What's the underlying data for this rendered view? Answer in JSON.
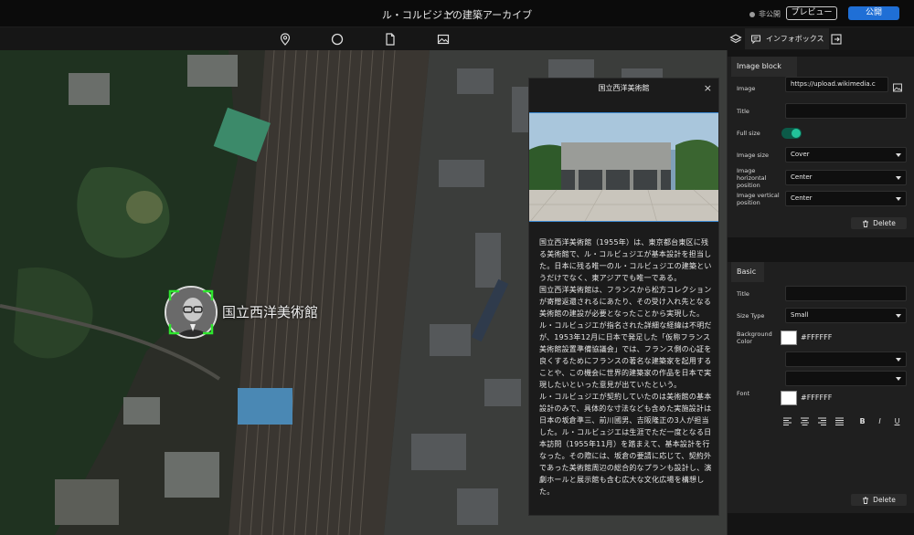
{
  "app": {
    "title": "ル・コルビジェの建築アーカイブ",
    "status": "非公開",
    "preview_label": "プレビュー",
    "publish_label": "公開"
  },
  "colors": {
    "accent": "#1f6fd6",
    "toggle_on": "#22c39a",
    "panel_bg": "#1f1f1f",
    "infobox_bg": "#1b1b1b",
    "marker_frame": "#2ee62e"
  },
  "toolbar": {
    "icons": [
      "pin-icon",
      "circle-icon",
      "file-icon",
      "image-icon"
    ],
    "right_icons": [
      "layers-icon",
      "comment-icon",
      "exit-icon"
    ],
    "info_tab_label": "インフォボックス"
  },
  "map": {
    "marker_label": "国立西洋美術館"
  },
  "infobox": {
    "title": "国立西洋美術館",
    "close": "×",
    "paragraphs": [
      "国立西洋美術館（1955年）は、東京都台東区に残る美術館で、ル・コルビュジエが基本設計を担当した。日本に残る唯一のル・コルビュジエの建築というだけでなく、東アジアでも唯一である。",
      "国立西洋美術館は、フランスから松方コレクションが寄贈返還されるにあたり、その受け入れ先となる美術館の建設が必要となったことから実現した。ル・コルビュジエが指名された詳細な経緯は不明だが、1953年12月に日本で発足した「仮称フランス美術館設置準備協議会」では、フランス側の心証を良くするためにフランスの著名な建築家を起用することや、この機会に世界的建築家の作品を日本で実現したいといった意見が出ていたという。",
      "ル・コルビュジエが契約していたのは美術館の基本設計のみで、具体的な寸法なども含めた実施設計は日本の坂倉準三、前川國男、吉阪隆正の3人が担当した。ル・コルビュジエは生涯でただ一度となる日本訪問（1955年11月）を踏まえて、基本設計を行なった。その際には、坂倉の要請に応じて、契約外であった美術館周辺の総合的なプランも設計し、演劇ホールと展示館も含む広大な文化広場を構想した。"
    ]
  },
  "panel": {
    "image_block": {
      "tab": "Image block",
      "image_label": "Image",
      "image_value": "https://upload.wikimedia.c",
      "title_label": "Title",
      "title_value": "",
      "fullsize_label": "Full size",
      "fullsize_on": true,
      "size_label": "Image size",
      "size_value": "Cover",
      "hpos_label": "Image horizontal position",
      "hpos_value": "Center",
      "vpos_label": "Image vertical position",
      "vpos_value": "Center",
      "delete_label": "Delete"
    },
    "basic": {
      "tab": "Basic",
      "title_label": "Title",
      "title_value": "",
      "sizetype_label": "Size Type",
      "sizetype_value": "Small",
      "bg_label": "Background Color",
      "bg_value": "#FFFFFF",
      "select1_value": "",
      "select2_value": "",
      "font_label": "Font",
      "font_value": "#FFFFFF",
      "delete_label": "Delete",
      "format_buttons": {
        "bold": "B",
        "italic": "I",
        "underline": "U"
      }
    }
  }
}
